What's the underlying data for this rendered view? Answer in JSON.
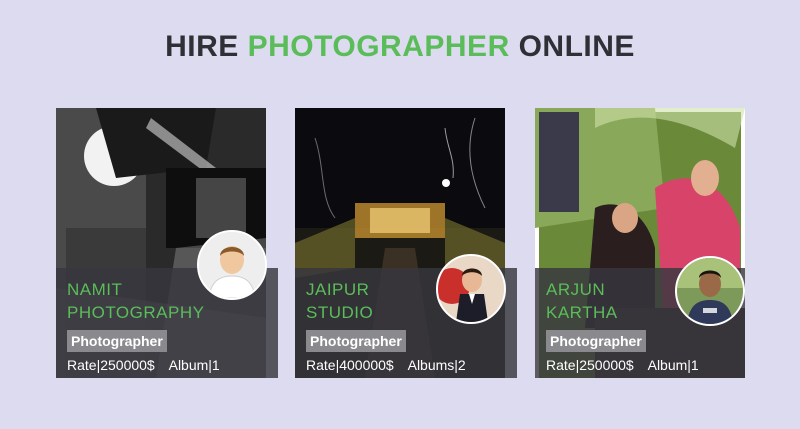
{
  "page": {
    "title_part1": "HIRE",
    "title_part2": "PHOTOGRAPHER",
    "title_part3": "ONLINE",
    "accent_color": "#5bbd5a"
  },
  "cards": [
    {
      "name": "NAMIT PHOTOGRAPHY",
      "role": "Photographer",
      "rate": "Rate|250000$",
      "album": "Album|1",
      "avatar_icon": "user-avatar-icon"
    },
    {
      "name": "JAIPUR STUDIO",
      "role": "Photographer",
      "rate": "Rate|400000$",
      "album": "Albums|2",
      "avatar_icon": "user-avatar-icon"
    },
    {
      "name": "ARJUN KARTHA",
      "role": "Photographer",
      "rate": "Rate|250000$",
      "album": "Album|1",
      "avatar_icon": "user-avatar-icon"
    }
  ]
}
